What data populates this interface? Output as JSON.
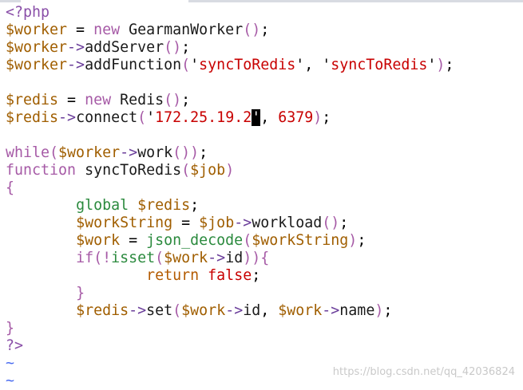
{
  "colors": {
    "background": "#ffffff",
    "php_tag": "#8a4fa8",
    "variable": "#a05e00",
    "keyword": "#a65aa6",
    "string": "#c80000",
    "number": "#c80000",
    "builtin_global": "#2b8a3e",
    "return_keyword": "#b35a00",
    "arrow_operator": "#6a3d9a",
    "tilde_marker": "#4a6cf0",
    "cursor": "#000000",
    "watermark": "#c9c9c9"
  },
  "editor": {
    "lines": [
      [
        {
          "t": "<?php",
          "c": "tag"
        }
      ],
      [
        {
          "t": "$worker",
          "c": "var"
        },
        {
          "t": " = ",
          "c": "op"
        },
        {
          "t": "new",
          "c": "kw"
        },
        {
          "t": " GearmanWorker",
          "c": "fn"
        },
        {
          "t": "()",
          "c": "kw"
        },
        {
          "t": ";",
          "c": "op"
        }
      ],
      [
        {
          "t": "$worker",
          "c": "var"
        },
        {
          "t": "->",
          "c": "arrow"
        },
        {
          "t": "addServer",
          "c": "fn"
        },
        {
          "t": "()",
          "c": "kw"
        },
        {
          "t": ";",
          "c": "op"
        }
      ],
      [
        {
          "t": "$worker",
          "c": "var"
        },
        {
          "t": "->",
          "c": "arrow"
        },
        {
          "t": "addFunction",
          "c": "fn"
        },
        {
          "t": "(",
          "c": "kw"
        },
        {
          "t": "'",
          "c": "op"
        },
        {
          "t": "syncToRedis",
          "c": "str"
        },
        {
          "t": "', '",
          "c": "op"
        },
        {
          "t": "syncToRedis",
          "c": "str"
        },
        {
          "t": "'",
          "c": "op"
        },
        {
          "t": ")",
          "c": "kw"
        },
        {
          "t": ";",
          "c": "op"
        }
      ],
      [],
      [
        {
          "t": "$redis",
          "c": "var"
        },
        {
          "t": " = ",
          "c": "op"
        },
        {
          "t": "new",
          "c": "kw"
        },
        {
          "t": " Redis",
          "c": "fn"
        },
        {
          "t": "()",
          "c": "kw"
        },
        {
          "t": ";",
          "c": "op"
        }
      ],
      [
        {
          "t": "$redis",
          "c": "var"
        },
        {
          "t": "->",
          "c": "arrow"
        },
        {
          "t": "connect",
          "c": "fn"
        },
        {
          "t": "(",
          "c": "kw"
        },
        {
          "t": "'",
          "c": "op"
        },
        {
          "t": "172.25.19.2",
          "c": "str"
        },
        {
          "t": "'",
          "c": "cursor"
        },
        {
          "t": ", ",
          "c": "op"
        },
        {
          "t": "6379",
          "c": "num"
        },
        {
          "t": ")",
          "c": "kw"
        },
        {
          "t": ";",
          "c": "op"
        }
      ],
      [],
      [
        {
          "t": "while",
          "c": "kw"
        },
        {
          "t": "(",
          "c": "kw"
        },
        {
          "t": "$worker",
          "c": "var"
        },
        {
          "t": "->",
          "c": "arrow"
        },
        {
          "t": "work",
          "c": "fn"
        },
        {
          "t": "())",
          "c": "kw"
        },
        {
          "t": ";",
          "c": "op"
        }
      ],
      [
        {
          "t": "function",
          "c": "kw"
        },
        {
          "t": " syncToRedis",
          "c": "fn"
        },
        {
          "t": "(",
          "c": "kw"
        },
        {
          "t": "$job",
          "c": "var"
        },
        {
          "t": ")",
          "c": "kw"
        }
      ],
      [
        {
          "t": "{",
          "c": "brace"
        }
      ],
      [
        {
          "t": "        ",
          "c": "op"
        },
        {
          "t": "global",
          "c": "global"
        },
        {
          "t": " ",
          "c": "op"
        },
        {
          "t": "$redis",
          "c": "var"
        },
        {
          "t": ";",
          "c": "op"
        }
      ],
      [
        {
          "t": "        ",
          "c": "op"
        },
        {
          "t": "$workString",
          "c": "var"
        },
        {
          "t": " = ",
          "c": "op"
        },
        {
          "t": "$job",
          "c": "var"
        },
        {
          "t": "->",
          "c": "arrow"
        },
        {
          "t": "workload",
          "c": "fn"
        },
        {
          "t": "()",
          "c": "kw"
        },
        {
          "t": ";",
          "c": "op"
        }
      ],
      [
        {
          "t": "        ",
          "c": "op"
        },
        {
          "t": "$work",
          "c": "var"
        },
        {
          "t": " = ",
          "c": "op"
        },
        {
          "t": "json_decode",
          "c": "global"
        },
        {
          "t": "(",
          "c": "kw"
        },
        {
          "t": "$workString",
          "c": "var"
        },
        {
          "t": ")",
          "c": "kw"
        },
        {
          "t": ";",
          "c": "op"
        }
      ],
      [
        {
          "t": "        ",
          "c": "op"
        },
        {
          "t": "if",
          "c": "kw"
        },
        {
          "t": "(!",
          "c": "kw"
        },
        {
          "t": "isset",
          "c": "global"
        },
        {
          "t": "(",
          "c": "kw"
        },
        {
          "t": "$work",
          "c": "var"
        },
        {
          "t": "->",
          "c": "arrow"
        },
        {
          "t": "id",
          "c": "fn"
        },
        {
          "t": ")){",
          "c": "kw"
        }
      ],
      [
        {
          "t": "                ",
          "c": "op"
        },
        {
          "t": "return",
          "c": "return"
        },
        {
          "t": " ",
          "c": "op"
        },
        {
          "t": "false",
          "c": "false"
        },
        {
          "t": ";",
          "c": "op"
        }
      ],
      [
        {
          "t": "        ",
          "c": "op"
        },
        {
          "t": "}",
          "c": "brace"
        }
      ],
      [
        {
          "t": "        ",
          "c": "op"
        },
        {
          "t": "$redis",
          "c": "var"
        },
        {
          "t": "->",
          "c": "arrow"
        },
        {
          "t": "set",
          "c": "fn"
        },
        {
          "t": "(",
          "c": "kw"
        },
        {
          "t": "$work",
          "c": "var"
        },
        {
          "t": "->",
          "c": "arrow"
        },
        {
          "t": "id",
          "c": "fn"
        },
        {
          "t": ", ",
          "c": "op"
        },
        {
          "t": "$work",
          "c": "var"
        },
        {
          "t": "->",
          "c": "arrow"
        },
        {
          "t": "name",
          "c": "fn"
        },
        {
          "t": ")",
          "c": "kw"
        },
        {
          "t": ";",
          "c": "op"
        }
      ],
      [
        {
          "t": "}",
          "c": "brace"
        }
      ],
      [
        {
          "t": "?>",
          "c": "tag"
        }
      ],
      [
        {
          "t": "~",
          "c": "tilde"
        }
      ],
      [
        {
          "t": "~",
          "c": "tilde"
        }
      ]
    ]
  },
  "watermark": {
    "text": "https://blog.csdn.net/qq_42036824"
  }
}
